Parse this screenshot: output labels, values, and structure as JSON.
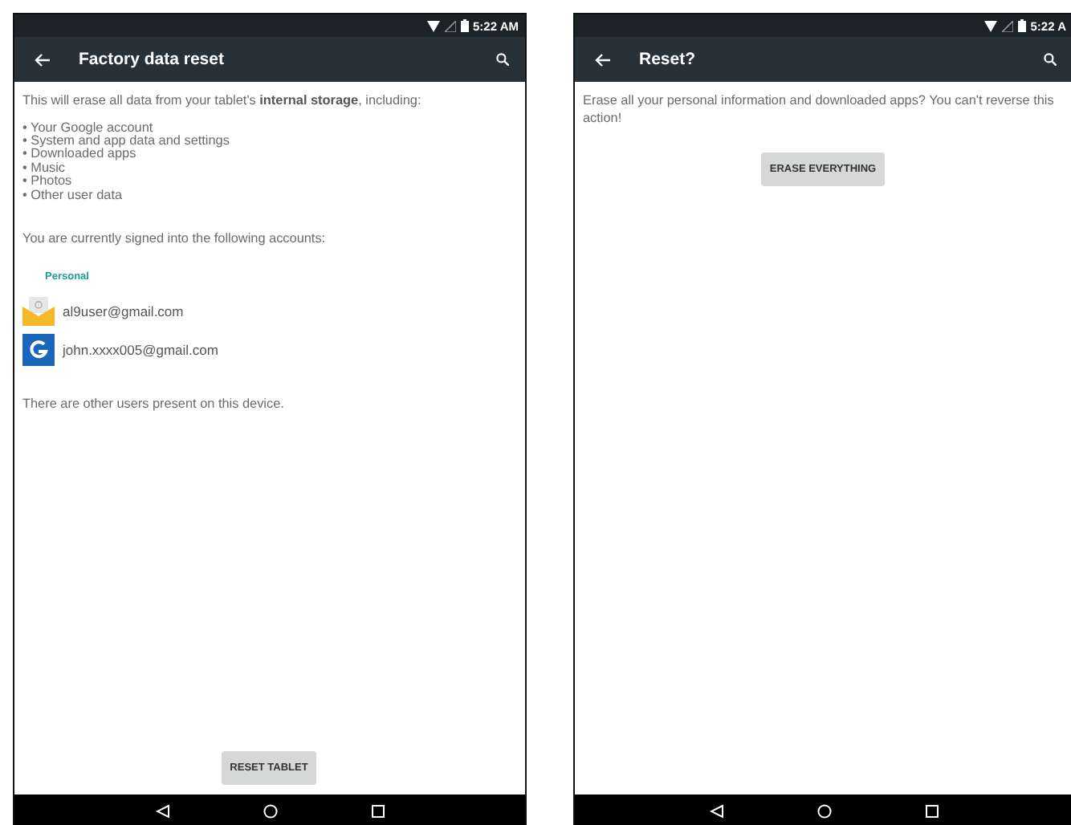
{
  "screens": [
    {
      "status_bar": {
        "time": "5:22 AM"
      },
      "toolbar": {
        "title": "Factory data reset"
      },
      "intro": "This will erase all data from your tablet's **internal storage**, including:",
      "erase_items": [
        "• Your Google account",
        "• System and app data and settings",
        "• Downloaded apps",
        "• Music",
        "• Photos",
        "• Other user data"
      ],
      "accounts_text": "You are currently signed into the following accounts:",
      "accounts_section": "Personal",
      "accounts": [
        {
          "kind": "email",
          "address": "al9user@gmail.com"
        },
        {
          "kind": "google",
          "address": "john.xxxx005@gmail.com"
        }
      ],
      "footer_text": "There are other users present on this device.",
      "bottom_button": {
        "label": "RESET TABLET"
      }
    },
    {
      "status_bar": {
        "time": "5:22 A"
      },
      "toolbar": {
        "title": "Reset?"
      },
      "intro": "Erase all your personal information and downloaded apps? You can't reverse this action!",
      "top_button": {
        "label": "ERASE EVERYTHING"
      }
    }
  ]
}
